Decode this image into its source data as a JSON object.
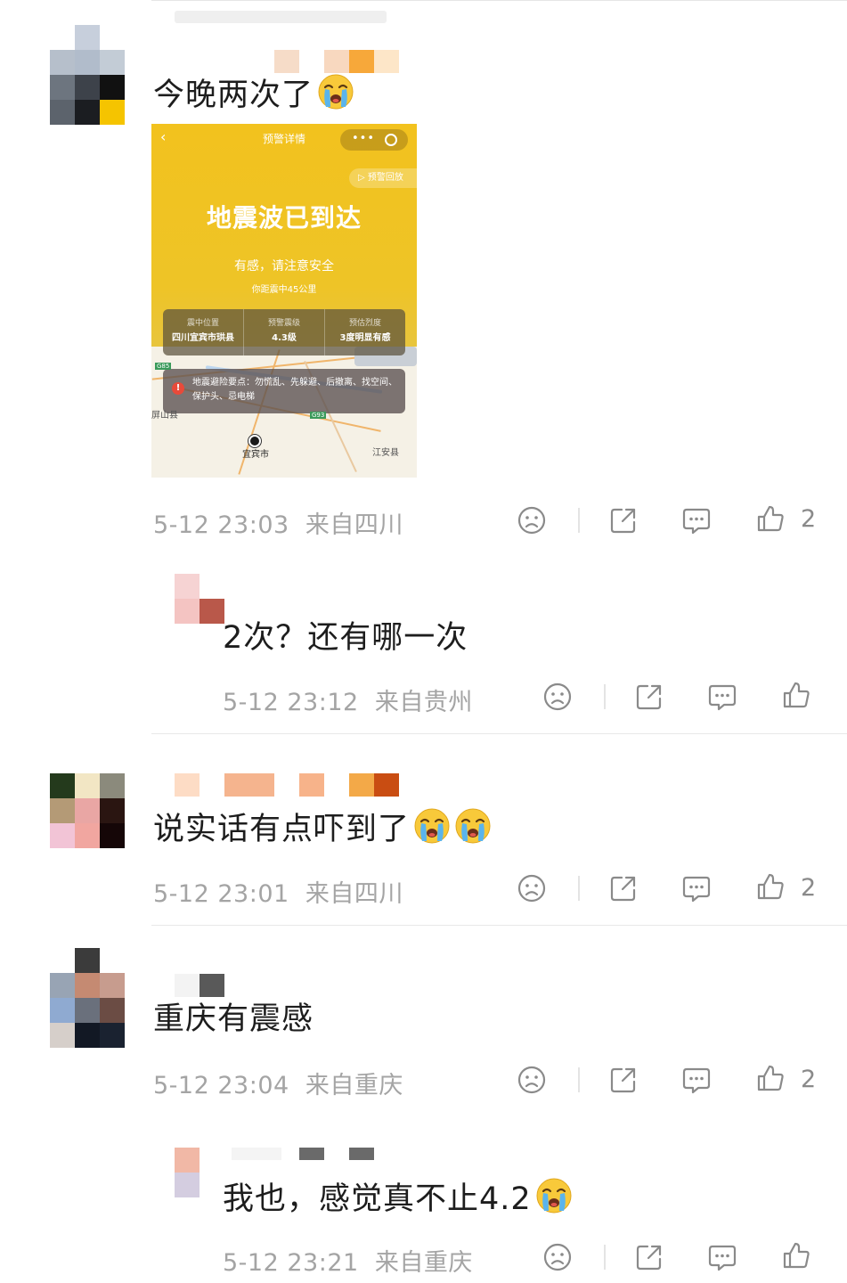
{
  "comments": [
    {
      "text": "今晚两次了",
      "emojis": [
        "crying-emoji"
      ],
      "time": "5-12 23:03",
      "location": "来自四川",
      "likes": "2",
      "screenshot": {
        "title": "预警详情",
        "replay": "预警回放",
        "headline": "地震波已到达",
        "felt": "有感，请注意安全",
        "distance": "你距震中45公里",
        "info": [
          {
            "label": "震中位置",
            "value": "四川宜宾市珙县"
          },
          {
            "label": "预警震级",
            "value": "4.3级"
          },
          {
            "label": "预估烈度",
            "value": "3度明显有感"
          }
        ],
        "tips": "地震避险要点：勿慌乱、先躲避、后撤离、找空间、保护头、忌电梯",
        "map_labels": {
          "city": "宜宾市",
          "county": "江安县",
          "west": "屏山县",
          "road1": "G93",
          "road2": "G85"
        }
      }
    },
    {
      "text": "2次？还有哪一次",
      "time": "5-12 23:12",
      "location": "来自贵州",
      "likes": ""
    },
    {
      "text": "说实话有点吓到了",
      "emojis": [
        "crying-emoji",
        "crying-emoji"
      ],
      "time": "5-12 23:01",
      "location": "来自四川",
      "likes": "2"
    },
    {
      "text": "重庆有震感",
      "time": "5-12 23:04",
      "location": "来自重庆",
      "likes": "2"
    },
    {
      "text": "我也，感觉真不止4.2",
      "emojis": [
        "crying-emoji"
      ],
      "time": "5-12 23:21",
      "location": "来自重庆",
      "likes": ""
    }
  ],
  "icons": [
    "sad-face-icon",
    "share-icon",
    "comment-icon",
    "thumbs-up-icon"
  ],
  "colors": {
    "alert_yellow": "#f2c21e",
    "meta_gray": "#a4a4a4",
    "text": "#1d1d1d"
  }
}
